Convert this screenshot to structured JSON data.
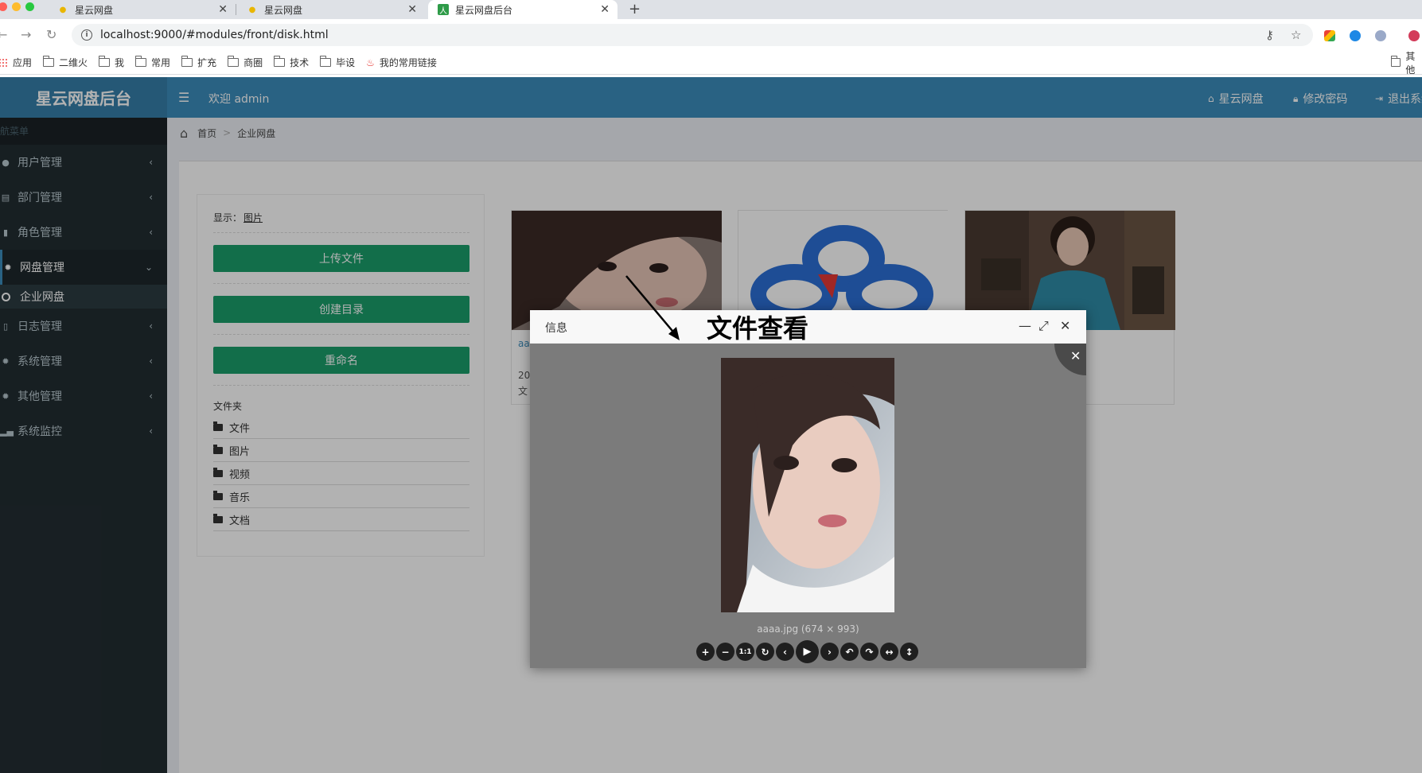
{
  "browser": {
    "tabs": [
      {
        "title": "星云网盘",
        "active": false
      },
      {
        "title": "星云网盘",
        "active": false
      },
      {
        "title": "星云网盘后台",
        "active": true
      }
    ],
    "new_tab": "+",
    "url": "localhost:9000/#modules/front/disk.html",
    "bookmarks": [
      {
        "label": "应用",
        "icon": "apps-icon"
      },
      {
        "label": "二维火",
        "icon": "folder-icon"
      },
      {
        "label": "我",
        "icon": "folder-icon"
      },
      {
        "label": "常用",
        "icon": "folder-icon"
      },
      {
        "label": "扩充",
        "icon": "folder-icon"
      },
      {
        "label": "商圈",
        "icon": "folder-icon"
      },
      {
        "label": "技术",
        "icon": "folder-icon"
      },
      {
        "label": "毕设",
        "icon": "folder-icon"
      },
      {
        "label": "我的常用链接",
        "icon": "flame-icon"
      }
    ],
    "other_bookmarks": "其他"
  },
  "header": {
    "logo": "星云网盘后台",
    "welcome": "欢迎 admin",
    "nav": [
      {
        "label": "星云网盘",
        "icon": "home-icon"
      },
      {
        "label": "修改密码",
        "icon": "lock-icon"
      },
      {
        "label": "退出系统",
        "icon": "logout-icon"
      }
    ]
  },
  "sidebar": {
    "header": "导航菜单",
    "items": [
      {
        "label": "用户管理",
        "icon": "user-icon"
      },
      {
        "label": "部门管理",
        "icon": "id-card-icon"
      },
      {
        "label": "角色管理",
        "icon": "role-icon"
      },
      {
        "label": "网盘管理",
        "icon": "gear-icon"
      },
      {
        "label": "日志管理",
        "icon": "file-icon"
      },
      {
        "label": "系统管理",
        "icon": "gear-icon"
      },
      {
        "label": "其他管理",
        "icon": "gear-icon"
      },
      {
        "label": "系统监控",
        "icon": "chart-icon"
      }
    ],
    "sub_item": "企业网盘"
  },
  "breadcrumb": {
    "home": "首页",
    "current": "企业网盘",
    "sep": ">"
  },
  "left_panel": {
    "show_label": "显示：",
    "show_value": "图片",
    "buttons": [
      "上传文件",
      "创建目录",
      "重命名"
    ],
    "folders_title": "文件夹",
    "folders": [
      "文件",
      "图片",
      "视频",
      "音乐",
      "文档"
    ]
  },
  "cards": [
    {
      "name_partial": "aa",
      "date_partial": "20",
      "type_partial": "文"
    },
    {
      "name_partial": "",
      "date_partial": "",
      "type_partial": ""
    },
    {
      "name_partial": "",
      "date_partial": "",
      "type_partial": ""
    }
  ],
  "dialog": {
    "title": "信息",
    "caption": "aaaa.jpg (674 × 993)",
    "toolbar": [
      "zoom-in",
      "zoom-out",
      "one-to-one",
      "reset",
      "prev",
      "play",
      "next",
      "rotate-left",
      "rotate-right",
      "flip-horizontal",
      "flip-vertical"
    ],
    "toolbar_labels": {
      "one_to_one": "1:1"
    }
  },
  "annotation": {
    "text": "文件查看"
  },
  "colors": {
    "header_bg": "#3c8dbc",
    "logo_bg": "#367fa9",
    "sidebar_bg": "#222d32",
    "button_green": "#1b9e6b",
    "content_bg": "#ecf0f5"
  }
}
